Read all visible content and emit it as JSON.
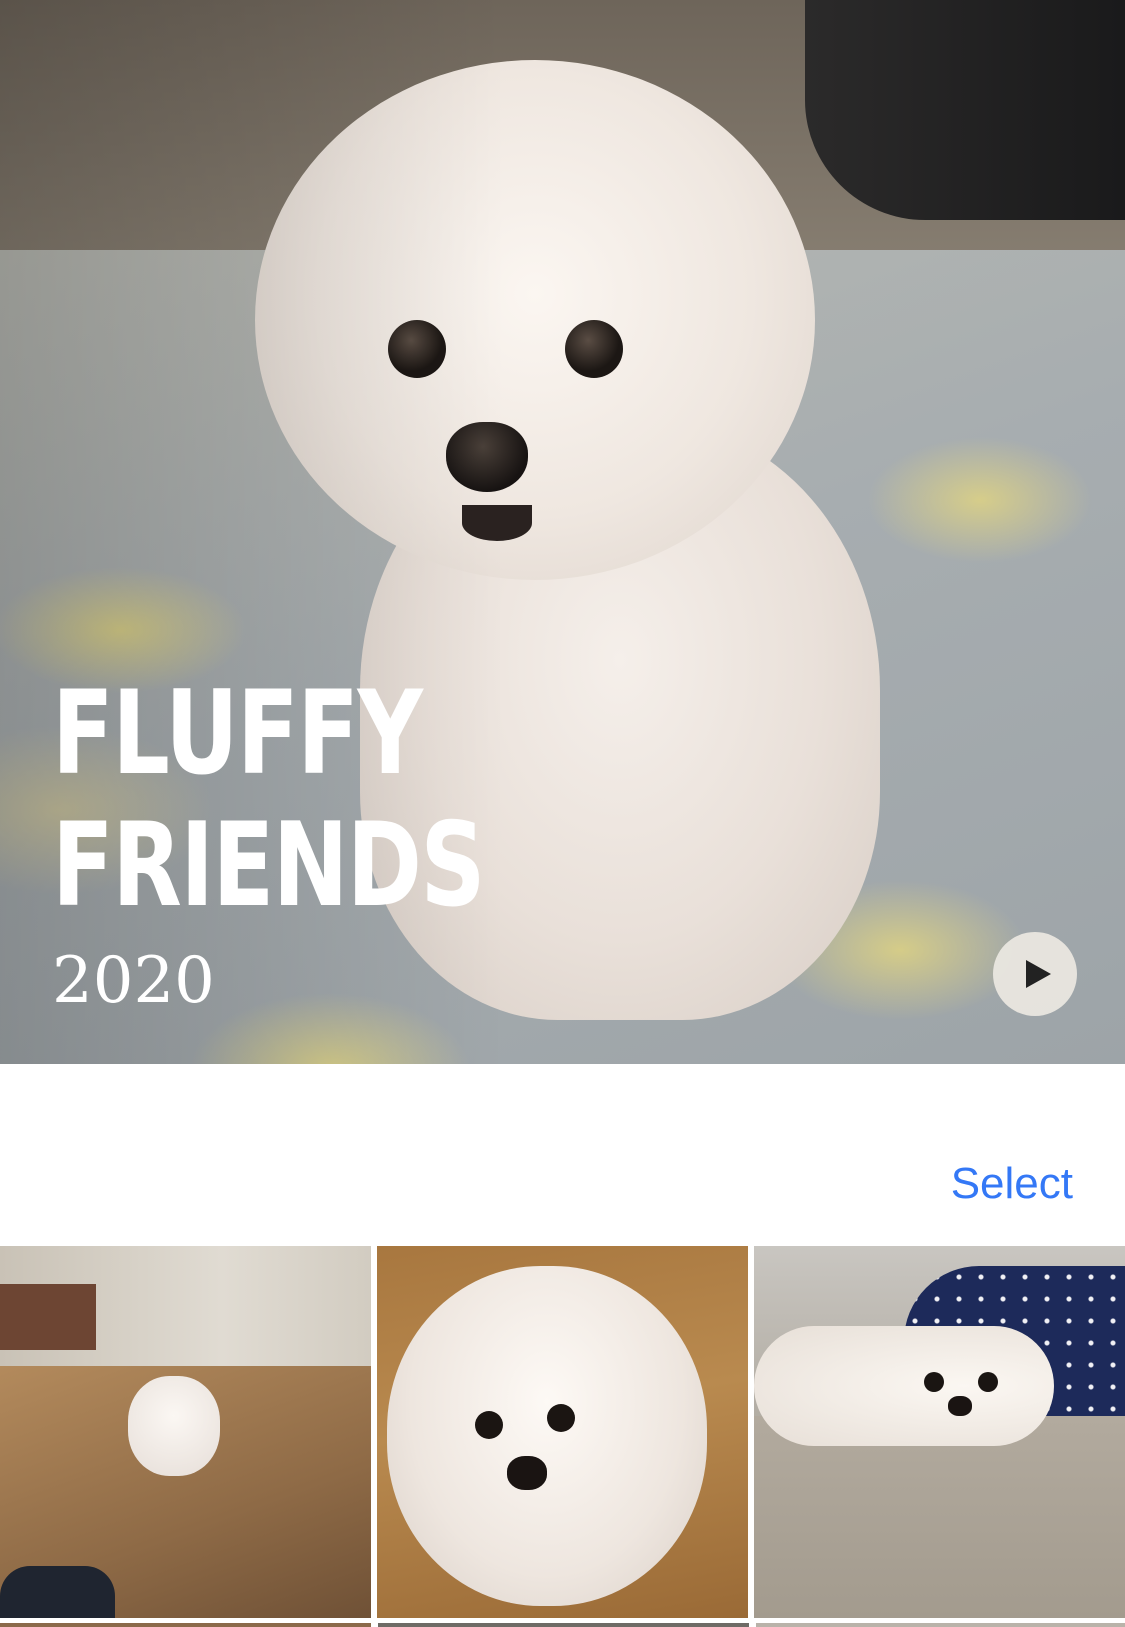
{
  "hero": {
    "title_line1": "FLUFFY",
    "title_line2": "FRIENDS",
    "year": "2020",
    "play_icon": "play-icon"
  },
  "toolbar": {
    "select_label": "Select"
  },
  "photos": [
    {
      "name": "photo-thumbnail"
    },
    {
      "name": "photo-thumbnail"
    },
    {
      "name": "photo-thumbnail"
    }
  ],
  "colors": {
    "accent": "#3478f6",
    "background": "#ffffff",
    "title_text": "#ffffff"
  }
}
